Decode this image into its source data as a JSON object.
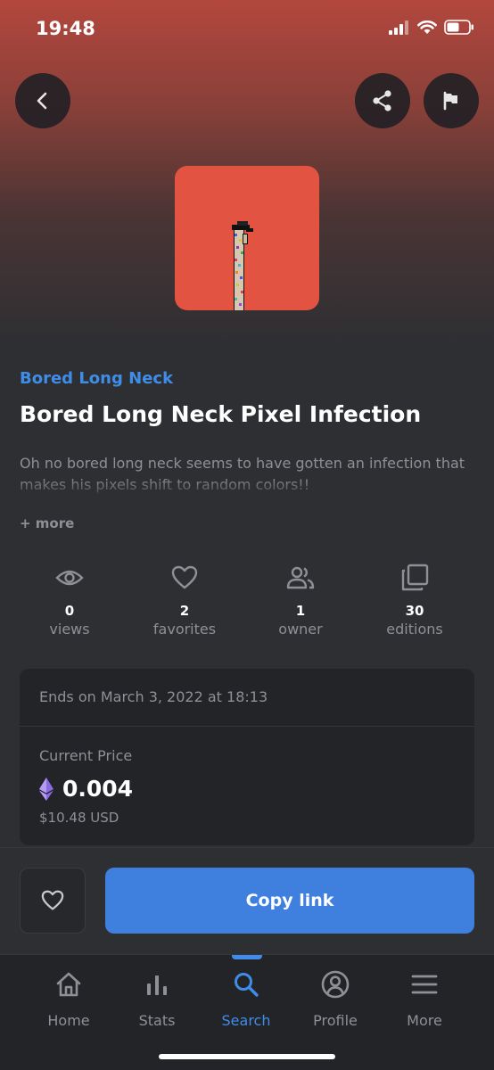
{
  "status_bar": {
    "time": "19:48"
  },
  "colors": {
    "accent": "#3f8de8",
    "button": "#3f80df",
    "artwork_bg": "#e25341"
  },
  "artwork": {
    "collection": "Bored Long Neck",
    "title": "Bored Long Neck Pixel Infection"
  },
  "description": {
    "text": "Oh no bored long neck seems to have gotten an infection that makes his pixels shift to random colors!!",
    "more_label": "+ more"
  },
  "stats": [
    {
      "icon": "eye-icon",
      "value": "0",
      "label": "views"
    },
    {
      "icon": "heart-icon",
      "value": "2",
      "label": "favorites"
    },
    {
      "icon": "users-icon",
      "value": "1",
      "label": "owner"
    },
    {
      "icon": "copy-icon",
      "value": "30",
      "label": "editions"
    }
  ],
  "auction": {
    "ends": "Ends on March 3, 2022 at 18:13",
    "price_label": "Current Price",
    "price": "0.004",
    "currency_icon": "ethereum-icon",
    "usd": "$10.48 USD"
  },
  "actions": {
    "copy_link": "Copy link"
  },
  "tabs": [
    {
      "icon": "home-icon",
      "label": "Home",
      "active": false
    },
    {
      "icon": "bar-chart-icon",
      "label": "Stats",
      "active": false
    },
    {
      "icon": "search-icon",
      "label": "Search",
      "active": true
    },
    {
      "icon": "profile-icon",
      "label": "Profile",
      "active": false
    },
    {
      "icon": "menu-icon",
      "label": "More",
      "active": false
    }
  ]
}
